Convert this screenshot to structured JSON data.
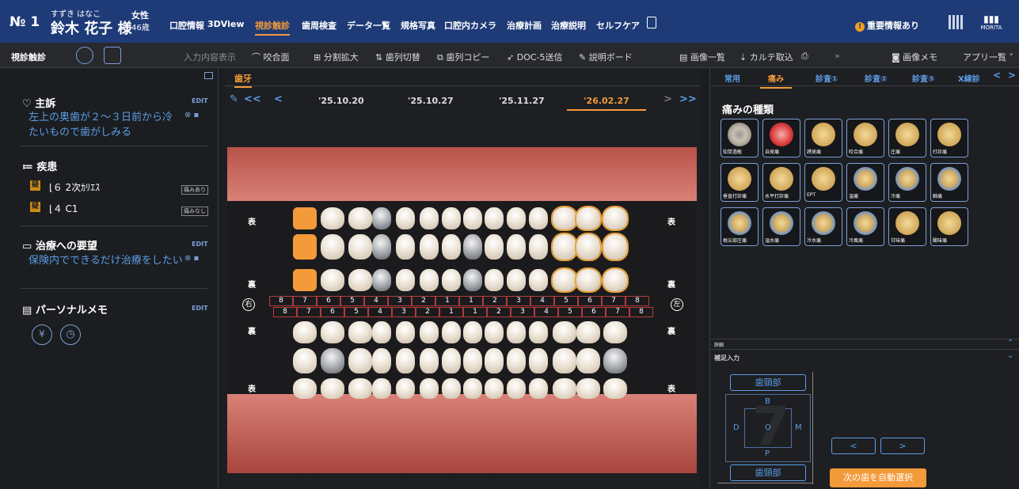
{
  "patient": {
    "no": "№ 1",
    "kana": "すずき はなこ",
    "name": "鈴木 花子 様",
    "sex": "女性",
    "age": "46歳"
  },
  "nav_tabs": [
    "口腔情報",
    "3DView",
    "視診触診",
    "歯周検査",
    "データ一覧",
    "規格写真",
    "口腔内カメラ",
    "治療計画",
    "治療説明",
    "セルフケア"
  ],
  "active_nav": "視診触診",
  "alert": "重要情報あり",
  "logo": "MORITA",
  "toolbar": {
    "mode": "視診触診",
    "items": [
      "入力内容表示",
      "咬合面",
      "分割拡大",
      "歯列切替",
      "歯列コピー",
      "DOC-5送信",
      "説明ボード",
      "画像一覧",
      "カルテ取込",
      "画像メモ",
      "アプリ一覧"
    ]
  },
  "left": {
    "chief_complaint": {
      "title": "主訴",
      "edit": "EDIT",
      "text": "左上の奥歯が２〜３日前から冷たいもので歯がしみる"
    },
    "disease": {
      "title": "疾患",
      "rows": [
        {
          "tooth": "６",
          "name": "2次ｶﾘｴｽ",
          "tag": "痛みあり"
        },
        {
          "tooth": "４",
          "name": "C1",
          "tag": "痛みなし"
        }
      ]
    },
    "request": {
      "title": "治療への要望",
      "edit": "EDIT",
      "text": "保険内でできるだけ治療をしたい"
    },
    "memo": {
      "title": "パーソナルメモ",
      "edit": "EDIT"
    }
  },
  "center": {
    "tab": "歯牙",
    "dates": [
      "'25.10.20",
      "'25.10.27",
      "'25.11.27",
      "'26.02.27"
    ],
    "active_date": "'26.02.27",
    "labels": {
      "front": "表",
      "back": "裏",
      "right": "右",
      "left": "左"
    },
    "upper_numbers": [
      "8",
      "7",
      "6",
      "5",
      "4",
      "3",
      "2",
      "1",
      "1",
      "2",
      "3",
      "4",
      "5",
      "6",
      "7",
      "8"
    ],
    "lower_numbers": [
      "8",
      "7",
      "6",
      "5",
      "4",
      "3",
      "2",
      "1",
      "1",
      "2",
      "3",
      "4",
      "5",
      "6",
      "7",
      "8"
    ]
  },
  "right": {
    "tabs": [
      "常用",
      "痛み",
      "診査①",
      "診査②",
      "診査③",
      "X線診"
    ],
    "active_tab": "痛み",
    "pain_title": "痛みの種類",
    "pain_items": [
      "知覚過敏",
      "自発痛",
      "誘発痛",
      "咬合痛",
      "圧痛",
      "打診痛",
      "垂直打診痛",
      "水平打診痛",
      "EPT",
      "温痛",
      "冷痛",
      "触痛",
      "根尖部圧痛",
      "温水痛",
      "冷水痛",
      "冷風痛",
      "甘味痛",
      "酸味痛"
    ],
    "detail_label": "詳細",
    "supplement_label": "補足入力",
    "surface_btn": "歯頸部",
    "surfaces": {
      "b": "B",
      "d": "D",
      "o": "O",
      "m": "M",
      "p": "P"
    },
    "tooth_number": "7",
    "prev": "<",
    "next": ">",
    "auto_select": "次の歯を自動選択"
  }
}
